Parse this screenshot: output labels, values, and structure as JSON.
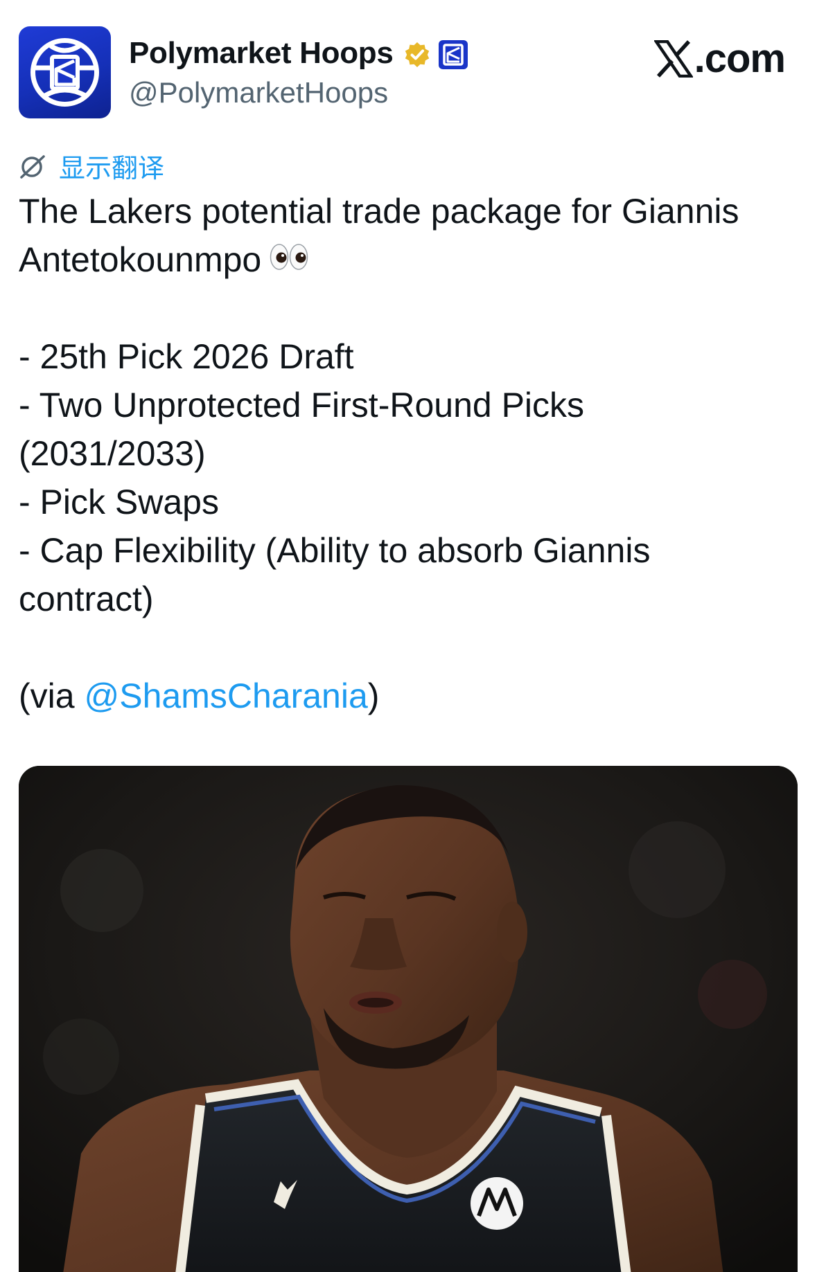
{
  "account": {
    "display_name": "Polymarket Hoops",
    "handle": "@PolymarketHoops",
    "verified": true,
    "avatar_icon": "polymarket-basketball-logo",
    "brand_color": "#1f3bd6"
  },
  "site": {
    "logo_text": ".com",
    "logo_icon": "x-icon"
  },
  "translate": {
    "label": "显示翻译",
    "icon": "translate-icon"
  },
  "tweet": {
    "line1": "The Lakers potential trade package for Giannis",
    "line2": "Antetokounmpo",
    "emoji": "eyes-emoji",
    "items": [
      "- 25th Pick 2026 Draft",
      "- Two Unprotected First-Round Picks",
      "(2031/2033)",
      "- Pick Swaps",
      "- Cap Flexibility (Ability to absorb Giannis",
      "contract)"
    ],
    "via_prefix": "(via ",
    "via_mention": "@ShamsCharania",
    "via_suffix": ")"
  },
  "media": {
    "kind": "photo",
    "subject": "basketball-player-photo"
  },
  "colors": {
    "link": "#1d9bf0",
    "text": "#0f1419",
    "secondary": "#536471",
    "verified_gold": "#e8b829"
  }
}
